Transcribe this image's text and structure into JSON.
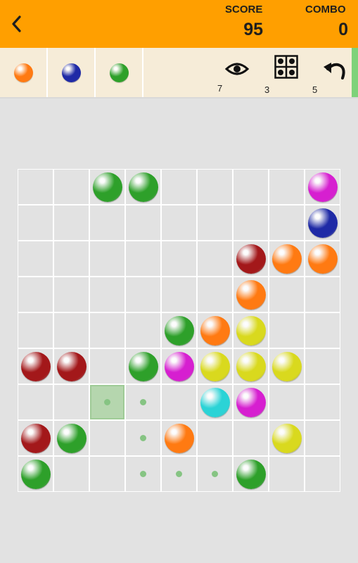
{
  "header": {
    "back_icon": "chevron-left-icon",
    "score_label": "SCORE",
    "score_value": "95",
    "combo_label": "COMBO",
    "combo_value": "0"
  },
  "next_balls": [
    "orange",
    "blue",
    "green"
  ],
  "tools": [
    {
      "name": "eye-icon",
      "count": "7"
    },
    {
      "name": "shuffle-grid-icon",
      "count": "3"
    },
    {
      "name": "undo-icon",
      "count": "5"
    }
  ],
  "colors": {
    "header_bg": "#ff9f00",
    "toolbar_bg": "#f6ecd8",
    "board_cell": "#e2e2e2",
    "path_dot": "#86c483",
    "selected_cell": "#b5d6ae",
    "green": "#2ea02a",
    "orange": "#ff7a12",
    "blue": "#1f2aa6",
    "red": "#a3181a",
    "magenta": "#d61fd0",
    "yellow": "#d9d91e",
    "cyan": "#2bd3d6"
  },
  "board": {
    "rows": 9,
    "cols": 9,
    "balls": [
      {
        "row": 0,
        "col": 2,
        "color": "green"
      },
      {
        "row": 0,
        "col": 3,
        "color": "green"
      },
      {
        "row": 0,
        "col": 8,
        "color": "magenta"
      },
      {
        "row": 1,
        "col": 8,
        "color": "blue"
      },
      {
        "row": 2,
        "col": 6,
        "color": "red"
      },
      {
        "row": 2,
        "col": 7,
        "color": "orange"
      },
      {
        "row": 2,
        "col": 8,
        "color": "orange"
      },
      {
        "row": 3,
        "col": 6,
        "color": "orange"
      },
      {
        "row": 4,
        "col": 4,
        "color": "green"
      },
      {
        "row": 4,
        "col": 5,
        "color": "orange"
      },
      {
        "row": 4,
        "col": 6,
        "color": "yellow"
      },
      {
        "row": 5,
        "col": 0,
        "color": "red"
      },
      {
        "row": 5,
        "col": 1,
        "color": "red"
      },
      {
        "row": 5,
        "col": 3,
        "color": "green"
      },
      {
        "row": 5,
        "col": 4,
        "color": "magenta"
      },
      {
        "row": 5,
        "col": 5,
        "color": "yellow"
      },
      {
        "row": 5,
        "col": 6,
        "color": "yellow"
      },
      {
        "row": 5,
        "col": 7,
        "color": "yellow"
      },
      {
        "row": 6,
        "col": 5,
        "color": "cyan"
      },
      {
        "row": 6,
        "col": 6,
        "color": "magenta"
      },
      {
        "row": 7,
        "col": 0,
        "color": "red"
      },
      {
        "row": 7,
        "col": 1,
        "color": "green"
      },
      {
        "row": 7,
        "col": 4,
        "color": "orange"
      },
      {
        "row": 7,
        "col": 7,
        "color": "yellow"
      },
      {
        "row": 8,
        "col": 0,
        "color": "green"
      },
      {
        "row": 8,
        "col": 6,
        "color": "green"
      }
    ],
    "selected": {
      "row": 6,
      "col": 2
    },
    "path_dots": [
      {
        "row": 6,
        "col": 2
      },
      {
        "row": 6,
        "col": 3
      },
      {
        "row": 7,
        "col": 3
      },
      {
        "row": 8,
        "col": 3
      },
      {
        "row": 8,
        "col": 4
      },
      {
        "row": 8,
        "col": 5
      }
    ]
  }
}
